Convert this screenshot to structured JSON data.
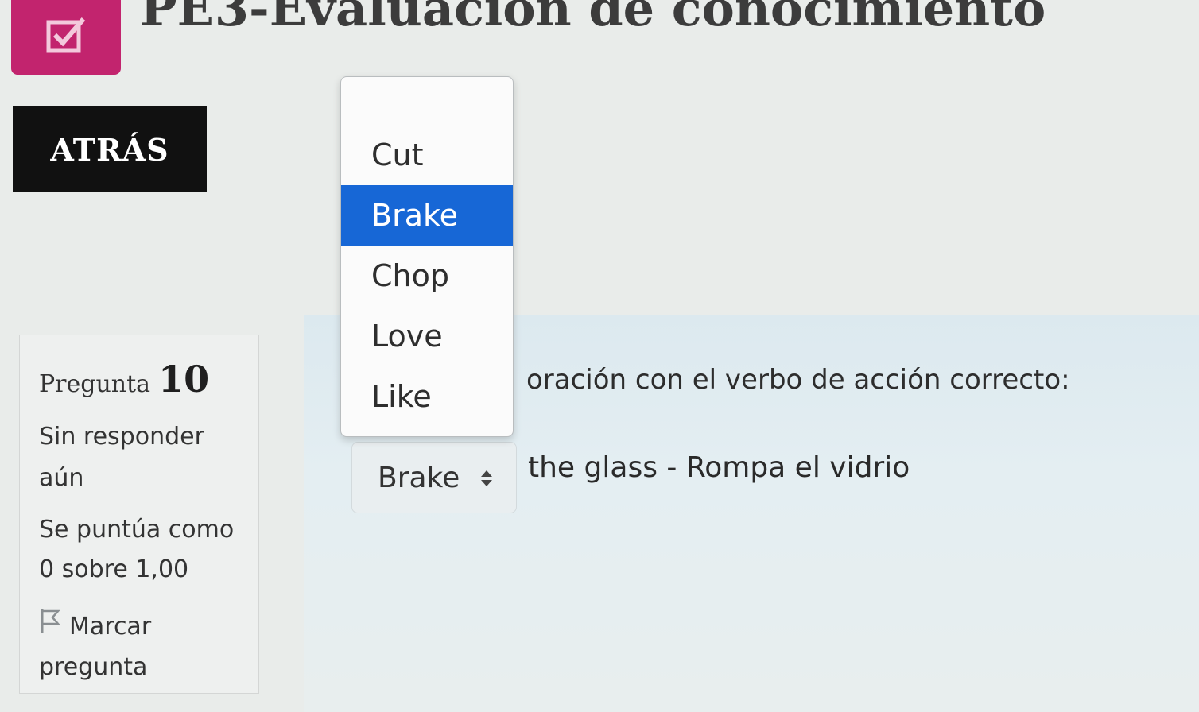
{
  "header": {
    "title": "PE3-Evaluación de conocimiento",
    "icon": "checkbox-edit-icon",
    "icon_bg": "#c2246e"
  },
  "nav": {
    "back_label": "ATRÁS"
  },
  "question_info": {
    "label": "Pregunta",
    "number": "10",
    "status": "Sin responder aún",
    "grade": "Se puntúa como 0 sobre 1,00",
    "flag_label": "Marcar pregunta",
    "flag_icon": "flag-icon"
  },
  "question": {
    "prompt_visible": "oración con el verbo de acción correcto:",
    "select_value": "Brake",
    "sentence_rest": "the glass - Rompa el vidrio"
  },
  "dropdown": {
    "options": [
      "Cut",
      "Brake",
      "Chop",
      "Love",
      "Like"
    ],
    "selected": "Brake",
    "highlight_color": "#1767d6"
  }
}
